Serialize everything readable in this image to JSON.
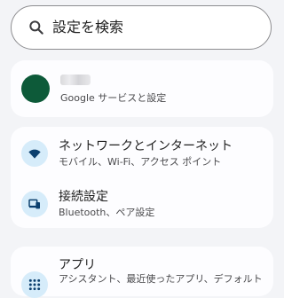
{
  "search": {
    "placeholder": "設定を検索",
    "icon": "search-icon"
  },
  "account": {
    "subtitle": "Google サービスと設定",
    "avatar_color": "#0d5a39"
  },
  "items": [
    {
      "title": "ネットワークとインターネット",
      "subtitle": "モバイル、Wi-Fi、アクセス ポイント",
      "icon": "wifi-icon"
    },
    {
      "title": "接続設定",
      "subtitle": "Bluetooth、ペア設定",
      "icon": "connected-devices-icon"
    },
    {
      "title": "アプリ",
      "subtitle": "アシスタント、最近使ったアプリ、デフォルト",
      "icon": "apps-grid-icon"
    }
  ],
  "colors": {
    "background": "#f3f4f7",
    "card": "#fdfdff",
    "icon_bg": "#d6ecfa",
    "icon_fg": "#0b3f6e"
  }
}
